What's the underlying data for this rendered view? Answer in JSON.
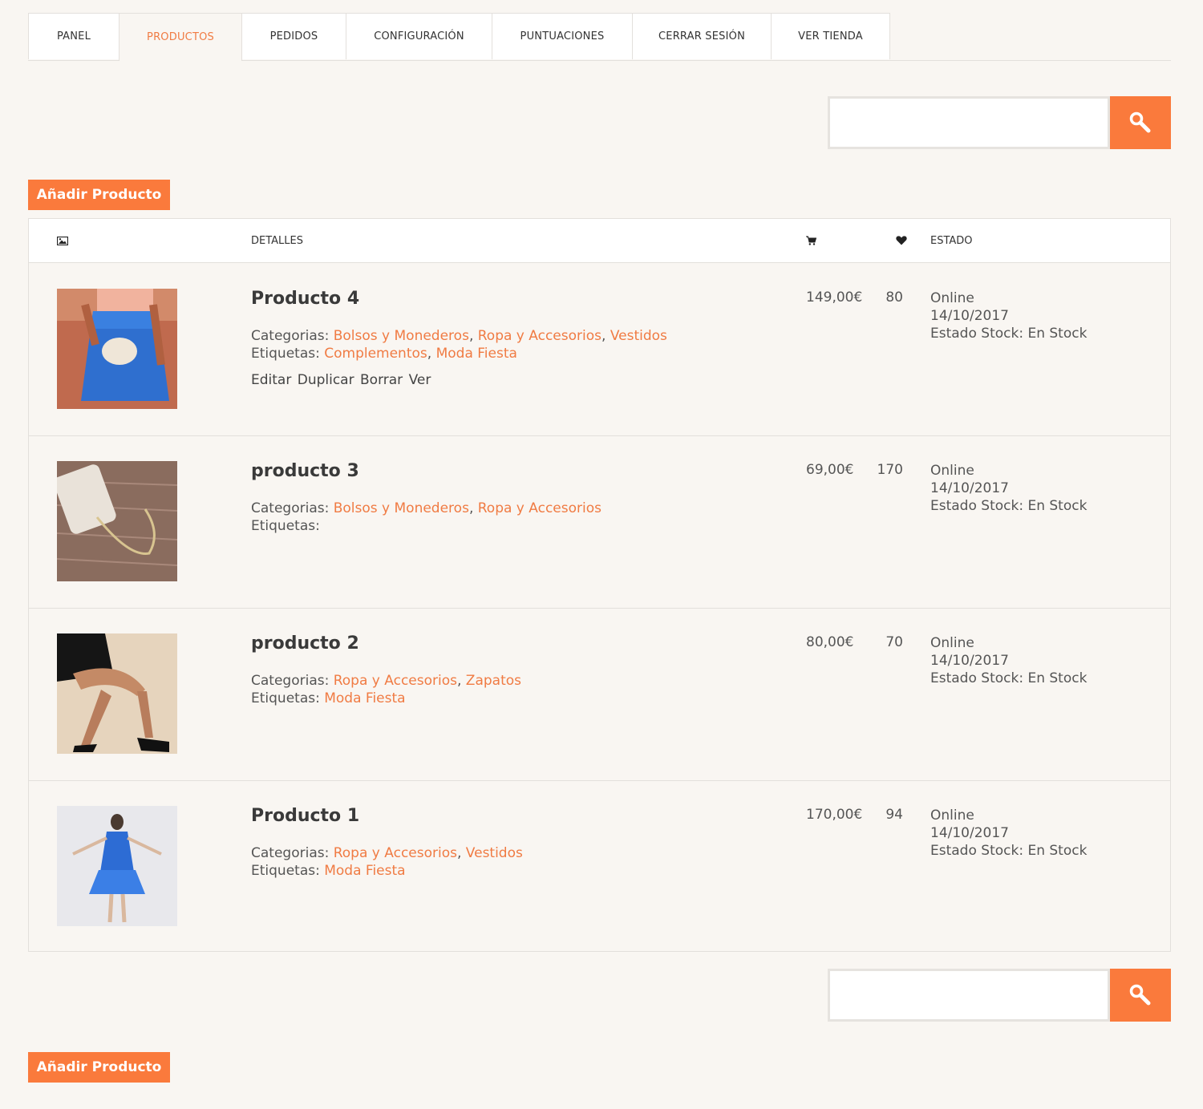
{
  "tabs": [
    {
      "label": "PANEL"
    },
    {
      "label": "PRODUCTOS"
    },
    {
      "label": "PEDIDOS"
    },
    {
      "label": "CONFIGURACIÓN"
    },
    {
      "label": "PUNTUACIONES"
    },
    {
      "label": "CERRAR SESIÓN"
    },
    {
      "label": "VER TIENDA"
    }
  ],
  "active_tab": "PRODUCTOS",
  "search": {
    "placeholder": ""
  },
  "add_button_label": "Añadir Producto",
  "table": {
    "headers": {
      "image_icon": "image-icon",
      "details": "DETALLES",
      "cart_icon": "cart-icon",
      "heart_icon": "heart-icon",
      "status": "ESTADO"
    },
    "labels": {
      "categories": "Categorias:",
      "tags": "Etiquetas:",
      "stock_prefix": "Estado Stock:"
    },
    "actions": [
      "Editar",
      "Duplicar",
      "Borrar",
      "Ver"
    ],
    "rows": [
      {
        "name": "Producto 4",
        "categories": [
          "Bolsos y Monederos",
          "Ropa y Accesorios",
          "Vestidos"
        ],
        "tags": [
          "Complementos",
          "Moda Fiesta"
        ],
        "price": "149,00€",
        "likes": "80",
        "status": "Online",
        "date": "14/10/2017",
        "stock": "En Stock",
        "show_actions": true
      },
      {
        "name": "producto 3",
        "categories": [
          "Bolsos y Monederos",
          "Ropa y Accesorios"
        ],
        "tags": [],
        "price": "69,00€",
        "likes": "170",
        "status": "Online",
        "date": "14/10/2017",
        "stock": "En Stock",
        "show_actions": false
      },
      {
        "name": "producto 2",
        "categories": [
          "Ropa y Accesorios",
          "Zapatos"
        ],
        "tags": [
          "Moda Fiesta"
        ],
        "price": "80,00€",
        "likes": "70",
        "status": "Online",
        "date": "14/10/2017",
        "stock": "En Stock",
        "show_actions": false
      },
      {
        "name": "Producto 1",
        "categories": [
          "Ropa y Accesorios",
          "Vestidos"
        ],
        "tags": [
          "Moda Fiesta"
        ],
        "price": "170,00€",
        "likes": "94",
        "status": "Online",
        "date": "14/10/2017",
        "stock": "En Stock",
        "show_actions": false
      }
    ]
  },
  "colors": {
    "accent": "#fa7a3c",
    "link": "#f07b43",
    "background": "#f9f6f2"
  }
}
